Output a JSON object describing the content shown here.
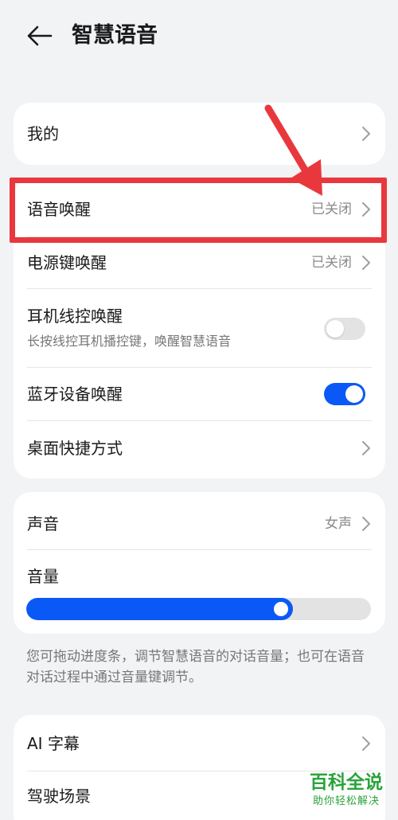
{
  "header": {
    "back_icon": "arrow-left-icon",
    "title": "智慧语音"
  },
  "card1": {
    "my": {
      "label": "我的"
    }
  },
  "card2": {
    "voice_wake": {
      "label": "语音唤醒",
      "value": "已关闭"
    },
    "power_key_wake": {
      "label": "电源键唤醒",
      "value": "已关闭"
    },
    "earphone_wake": {
      "label": "耳机线控唤醒",
      "sub": "长按线控耳机播控键，唤醒智慧语音",
      "enabled": false
    },
    "bluetooth_wake": {
      "label": "蓝牙设备唤醒",
      "enabled": true
    },
    "desktop_shortcut": {
      "label": "桌面快捷方式"
    }
  },
  "card3": {
    "sound": {
      "label": "声音",
      "value": "女声"
    },
    "volume": {
      "label": "音量",
      "level_percent": 75
    }
  },
  "note": "您可拖动进度条，调节智慧语音的对话音量；也可在语音对话过程中通过音量键调节。",
  "card4": {
    "ai_subtitle": {
      "label": "AI 字幕"
    },
    "driving_scene": {
      "label": "驾驶场景"
    }
  },
  "watermark": {
    "logo": "百科全说",
    "slogan": "助你轻松解决"
  },
  "colors": {
    "accent": "#0a59f7",
    "annotation_red": "#e8383d",
    "watermark_green": "#2aa33a",
    "background": "#f1f3f5"
  }
}
